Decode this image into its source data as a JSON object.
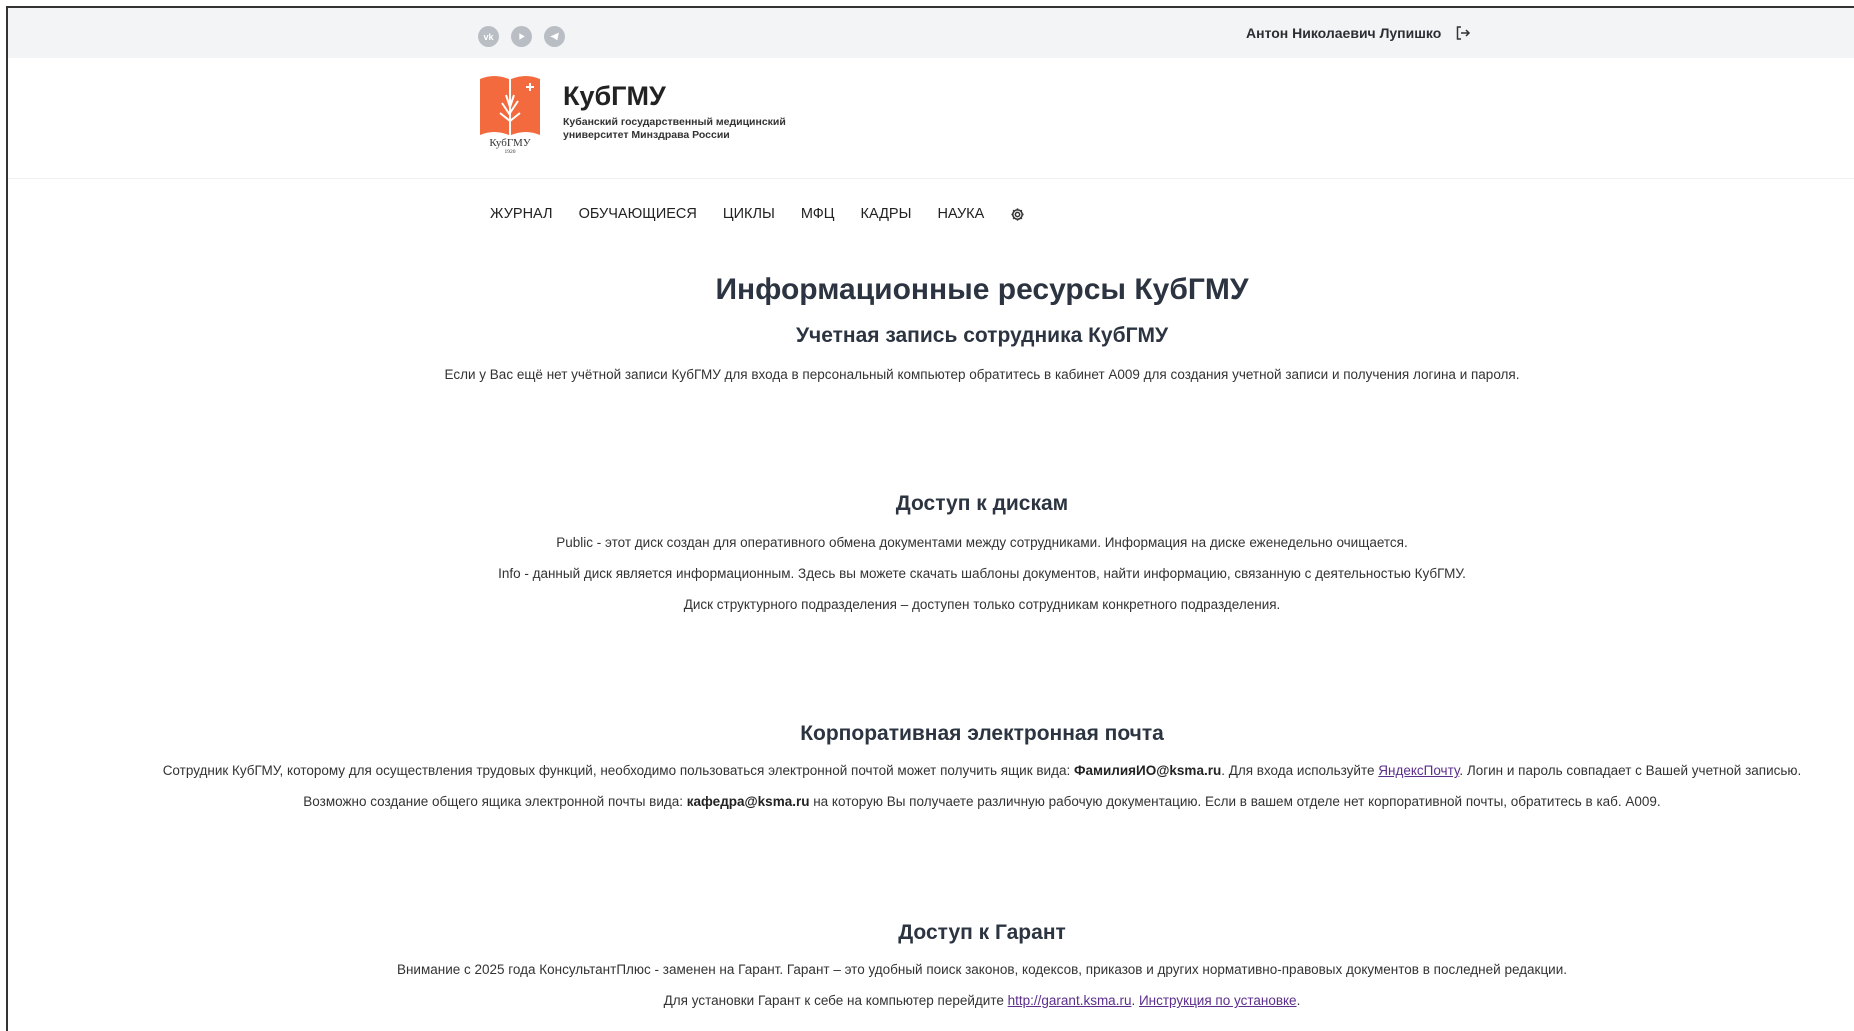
{
  "topbar": {
    "social": [
      "vk",
      "youtube",
      "telegram"
    ],
    "user_name": "Антон Николаевич Лупишко"
  },
  "header": {
    "brand_name": "КубГМУ",
    "brand_subtitle": "Кубанский государственный медицинский университет Минздрава России",
    "logo_caption": "КубГМУ",
    "logo_year": "1920"
  },
  "nav": {
    "items": [
      "ЖУРНАЛ",
      "ОБУЧАЮЩИЕСЯ",
      "ЦИКЛЫ",
      "МФЦ",
      "КАДРЫ",
      "НАУКА"
    ]
  },
  "page": {
    "title": "Информационные ресурсы КубГМУ",
    "account": {
      "heading": "Учетная запись сотрудника КубГМУ",
      "text": "Если у Вас ещё нет учётной записи КубГМУ для входа в персональный компьютер обратитесь в кабинет А009 для создания учетной записи и получения логина и пароля."
    },
    "disks": {
      "heading": "Доступ к дискам",
      "line1": "Public - этот диск создан для оперативного обмена документами между сотрудниками. Информация на диске еженедельно очищается.",
      "line2": "Info - данный диск является информационным. Здесь вы можете скачать шаблоны документов, найти информацию, связанную с деятельностью КубГМУ.",
      "line3": "Диск структурного подразделения – доступен только сотрудникам конкретного подразделения."
    },
    "mail": {
      "heading": "Корпоративная электронная почта",
      "l1_a": "Сотрудник КубГМУ, которому для осуществления трудовых функций, необходимо пользоваться электронной почтой может получить ящик вида: ",
      "l1_bold": "ФамилияИО@ksma.ru",
      "l1_b": ". Для входа используйте ",
      "l1_link": "ЯндексПочту",
      "l1_c": ". Логин и пароль совпадает с Вашей учетной записью.",
      "l2_a": "Возможно создание общего ящика электронной почты вида: ",
      "l2_bold": "кафедра@ksma.ru",
      "l2_b": " на которую Вы получаете различную рабочую документацию. Если в вашем отделе нет корпоративной почты, обратитесь в каб. А009."
    },
    "garant": {
      "heading": "Доступ к Гарант",
      "line1": "Внимание с 2025 года КонсультантПлюс - заменен на Гарант. Гарант – это удобный поиск законов, кодексов, приказов и других нормативно-правовых документов в последней редакции.",
      "l2_a": "Для установки Гарант к себе на компьютер перейдите ",
      "l2_link1": "http://garant.ksma.ru",
      "l2_sep": ". ",
      "l2_link2": "Инструкция по установке",
      "l2_end": "."
    }
  },
  "colors": {
    "logo_orange": "#f26a3d",
    "link": "#5b2e8c",
    "topbar_bg": "#f3f4f6"
  }
}
